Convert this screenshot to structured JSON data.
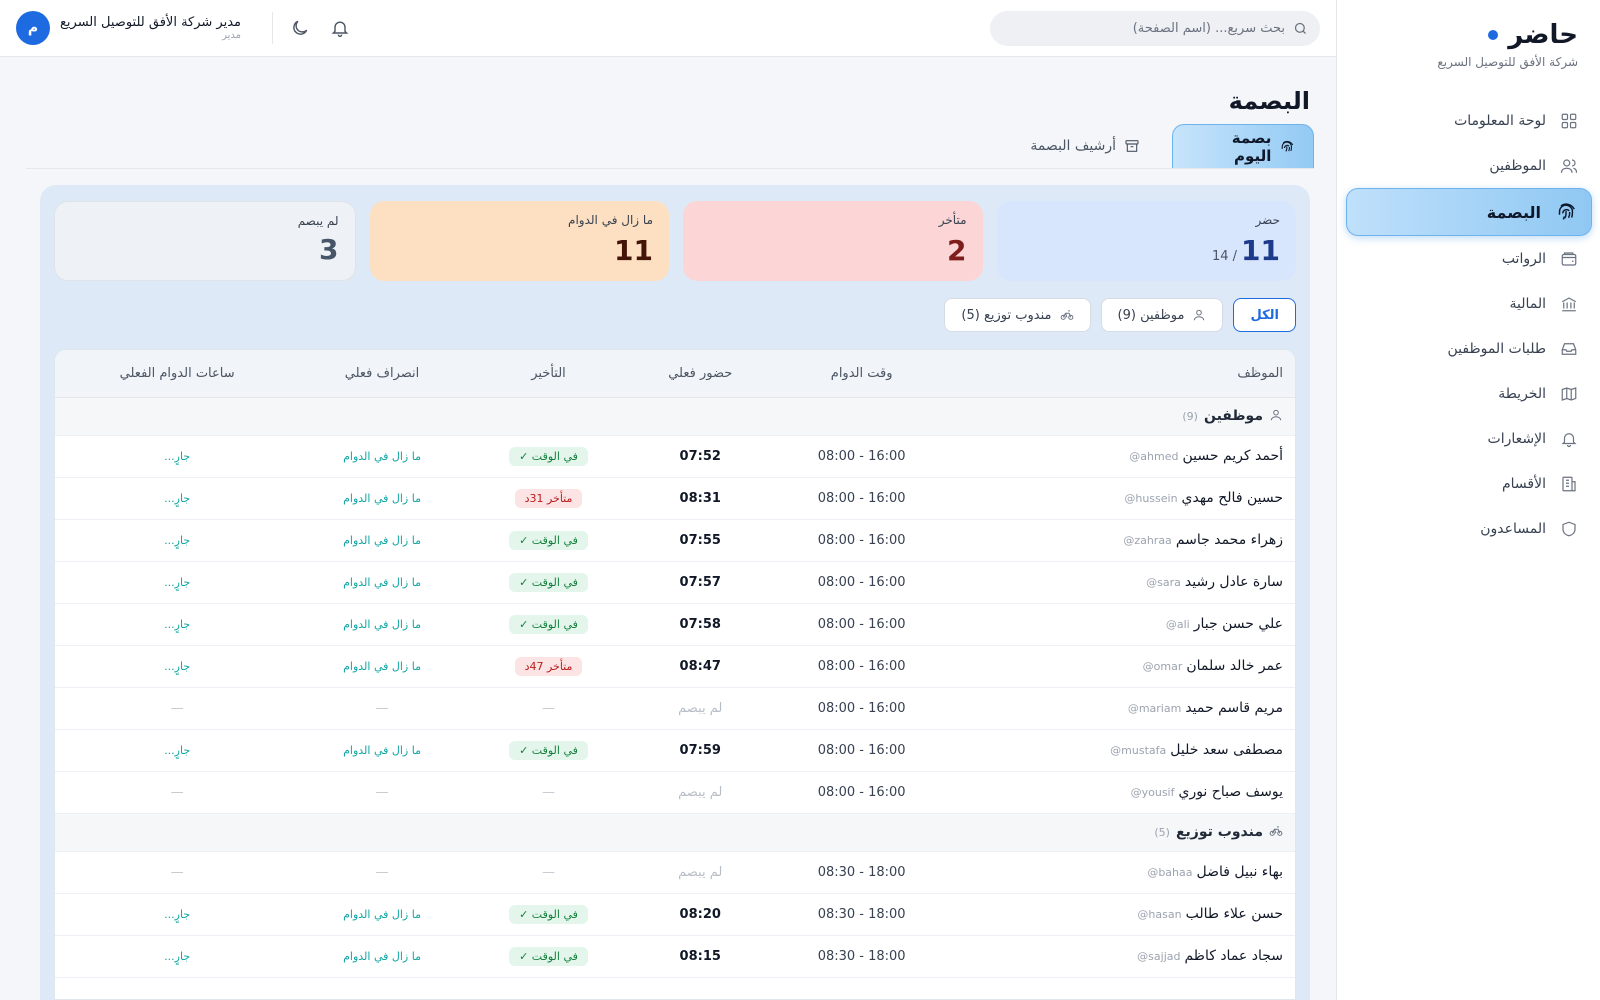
{
  "brand": {
    "name": "حاضر",
    "company": "شركة الأفق للتوصيل السريع"
  },
  "nav": [
    {
      "label": "لوحة المعلومات",
      "icon": "dashboard-icon",
      "active": false
    },
    {
      "label": "الموظفين",
      "icon": "users-icon",
      "active": false
    },
    {
      "label": "البصمة",
      "icon": "fingerprint-icon",
      "active": true
    },
    {
      "label": "الرواتب",
      "icon": "wallet-icon",
      "active": false
    },
    {
      "label": "المالية",
      "icon": "bank-icon",
      "active": false
    },
    {
      "label": "طلبات الموظفين",
      "icon": "inbox-icon",
      "active": false
    },
    {
      "label": "الخريطة",
      "icon": "map-icon",
      "active": false
    },
    {
      "label": "الإشعارات",
      "icon": "bell-icon",
      "active": false
    },
    {
      "label": "الأقسام",
      "icon": "building-icon",
      "active": false
    },
    {
      "label": "المساعدون",
      "icon": "shield-icon",
      "active": false
    }
  ],
  "topbar": {
    "search_placeholder": "بحث سريع... (اسم الصفحة)",
    "user_name": "مدير شركة الأفق للتوصيل السريع",
    "user_role": "مدير",
    "avatar_initial": "م"
  },
  "page": {
    "title": "البصمة",
    "tabs": [
      {
        "label": "بصمة اليوم",
        "active": true
      },
      {
        "label": "أرشيف البصمة",
        "active": false
      }
    ]
  },
  "stats": {
    "present": {
      "label": "حضر",
      "value": "11",
      "sub": "/ 14"
    },
    "late": {
      "label": "متأخر",
      "value": "2"
    },
    "still": {
      "label": "ما زال في الدوام",
      "value": "11"
    },
    "absent": {
      "label": "لم يبصم",
      "value": "3"
    }
  },
  "filters": [
    {
      "label": "الكل",
      "active": true
    },
    {
      "label": "موظفين (9)",
      "active": false
    },
    {
      "label": "مندوب توزيع (5)",
      "active": false
    }
  ],
  "table": {
    "headers": {
      "employee": "الموظف",
      "shift": "وقت الدوام",
      "checkin": "حضور فعلي",
      "delay": "التأخير",
      "checkout": "انصراف فعلي",
      "hours": "ساعات الدوام الفعلي"
    },
    "groups": [
      {
        "name": "موظفين",
        "count": "(9)",
        "rows": [
          {
            "name": "أحمد كريم حسين",
            "user": "@ahmed",
            "shift": "08:00 - 16:00",
            "checkin": "07:52",
            "delay": "في الوقت ✓",
            "delay_type": "ok",
            "checkout": "ما زال في الدوام",
            "hours": "جارٍ..."
          },
          {
            "name": "حسين فالح مهدي",
            "user": "@hussein",
            "shift": "08:00 - 16:00",
            "checkin": "08:31",
            "delay": "متأخر 31د",
            "delay_type": "late",
            "checkout": "ما زال في الدوام",
            "hours": "جارٍ..."
          },
          {
            "name": "زهراء محمد جاسم",
            "user": "@zahraa",
            "shift": "08:00 - 16:00",
            "checkin": "07:55",
            "delay": "في الوقت ✓",
            "delay_type": "ok",
            "checkout": "ما زال في الدوام",
            "hours": "جارٍ..."
          },
          {
            "name": "سارة عادل رشيد",
            "user": "@sara",
            "shift": "08:00 - 16:00",
            "checkin": "07:57",
            "delay": "في الوقت ✓",
            "delay_type": "ok",
            "checkout": "ما زال في الدوام",
            "hours": "جارٍ..."
          },
          {
            "name": "علي حسن جبار",
            "user": "@ali",
            "shift": "08:00 - 16:00",
            "checkin": "07:58",
            "delay": "في الوقت ✓",
            "delay_type": "ok",
            "checkout": "ما زال في الدوام",
            "hours": "جارٍ..."
          },
          {
            "name": "عمر خالد سلمان",
            "user": "@omar",
            "shift": "08:00 - 16:00",
            "checkin": "08:47",
            "delay": "متأخر 47د",
            "delay_type": "late",
            "checkout": "ما زال في الدوام",
            "hours": "جارٍ..."
          },
          {
            "name": "مريم قاسم حميد",
            "user": "@mariam",
            "shift": "08:00 - 16:00",
            "checkin": "لم يبصم",
            "delay": "—",
            "delay_type": "none",
            "checkout": "—",
            "hours": "—"
          },
          {
            "name": "مصطفى سعد خليل",
            "user": "@mustafa",
            "shift": "08:00 - 16:00",
            "checkin": "07:59",
            "delay": "في الوقت ✓",
            "delay_type": "ok",
            "checkout": "ما زال في الدوام",
            "hours": "جارٍ..."
          },
          {
            "name": "يوسف صباح نوري",
            "user": "@yousif",
            "shift": "08:00 - 16:00",
            "checkin": "لم يبصم",
            "delay": "—",
            "delay_type": "none",
            "checkout": "—",
            "hours": "—"
          }
        ]
      },
      {
        "name": "مندوب توزيع",
        "count": "(5)",
        "rows": [
          {
            "name": "بهاء نبيل فاضل",
            "user": "@bahaa",
            "shift": "08:30 - 18:00",
            "checkin": "لم يبصم",
            "delay": "—",
            "delay_type": "none",
            "checkout": "—",
            "hours": "—"
          },
          {
            "name": "حسن علاء طالب",
            "user": "@hasan",
            "shift": "08:30 - 18:00",
            "checkin": "08:20",
            "delay": "في الوقت ✓",
            "delay_type": "ok",
            "checkout": "ما زال في الدوام",
            "hours": "جارٍ..."
          },
          {
            "name": "سجاد عماد كاظم",
            "user": "@sajjad",
            "shift": "08:30 - 18:00",
            "checkin": "08:15",
            "delay": "في الوقت ✓",
            "delay_type": "ok",
            "checkout": "ما زال في الدوام",
            "hours": "جارٍ..."
          }
        ]
      }
    ]
  }
}
